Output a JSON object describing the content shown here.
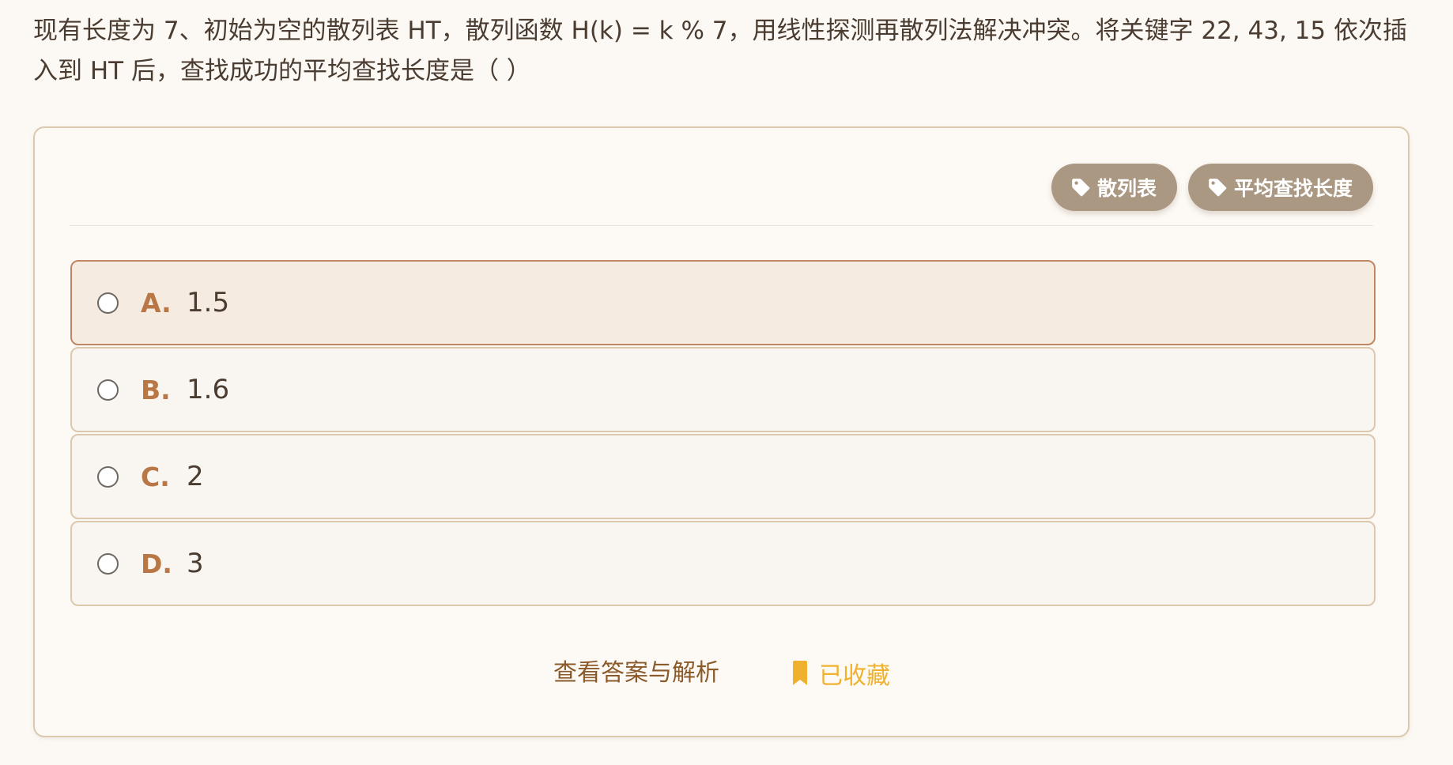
{
  "question": {
    "text": "现有长度为 7、初始为空的散列表 HT，散列函数 H(k) = k % 7，用线性探测再散列法解决冲突。将关键字 22, 43, 15 依次插入到 HT 后，查找成功的平均查找长度是（ ）"
  },
  "tags": [
    {
      "label": "散列表",
      "icon": "tag-icon"
    },
    {
      "label": "平均查找长度",
      "icon": "tag-icon"
    }
  ],
  "options": [
    {
      "letter": "A.",
      "text": "1.5"
    },
    {
      "letter": "B.",
      "text": "1.6"
    },
    {
      "letter": "C.",
      "text": "2"
    },
    {
      "letter": "D.",
      "text": "3"
    }
  ],
  "actions": {
    "view_answer_label": "查看答案与解析",
    "favorite_label": "已收藏",
    "favorite_icon": "bookmark-icon"
  },
  "colors": {
    "accent": "#b97746",
    "tag_bg": "#ab9882",
    "favorite": "#f0b22e",
    "link": "#8b5a2b"
  }
}
